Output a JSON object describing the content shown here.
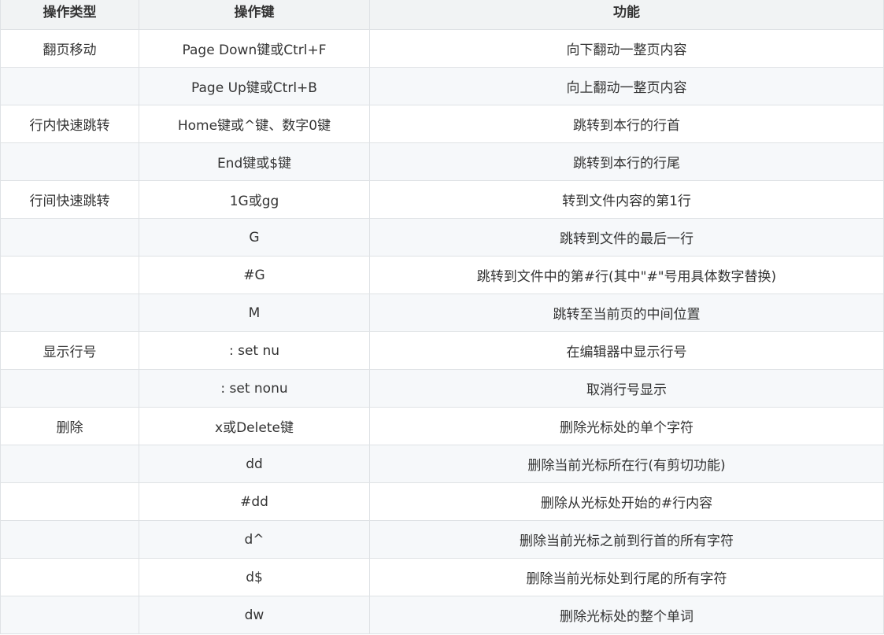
{
  "table": {
    "headers": [
      "操作类型",
      "操作键",
      "功能"
    ],
    "rows": [
      {
        "type": "翻页移动",
        "key": "Page Down键或Ctrl+F",
        "func": "向下翻动一整页内容"
      },
      {
        "type": "",
        "key": "Page Up键或Ctrl+B",
        "func": "向上翻动一整页内容"
      },
      {
        "type": "行内快速跳转",
        "key": "Home键或^键、数字0键",
        "func": "跳转到本行的行首"
      },
      {
        "type": "",
        "key": "End键或$键",
        "func": "跳转到本行的行尾"
      },
      {
        "type": "行间快速跳转",
        "key": "1G或gg",
        "func": "转到文件内容的第1行"
      },
      {
        "type": "",
        "key": "G",
        "func": "跳转到文件的最后一行"
      },
      {
        "type": "",
        "key": "#G",
        "func": "跳转到文件中的第#行(其中\"#\"号用具体数字替换)"
      },
      {
        "type": "",
        "key": "M",
        "func": "跳转至当前页的中间位置"
      },
      {
        "type": "显示行号",
        "key": ": set nu",
        "func": "在编辑器中显示行号"
      },
      {
        "type": "",
        "key": ": set nonu",
        "func": "取消行号显示"
      },
      {
        "type": "删除",
        "key": "x或Delete键",
        "func": "删除光标处的单个字符"
      },
      {
        "type": "",
        "key": "dd",
        "func": "删除当前光标所在行(有剪切功能)"
      },
      {
        "type": "",
        "key": "#dd",
        "func": "删除从光标处开始的#行内容"
      },
      {
        "type": "",
        "key": "d^",
        "func": "删除当前光标之前到行首的所有字符"
      },
      {
        "type": "",
        "key": "d$",
        "func": "删除当前光标处到行尾的所有字符"
      },
      {
        "type": "",
        "key": "dw",
        "func": "删除光标处的整个单词"
      }
    ]
  }
}
